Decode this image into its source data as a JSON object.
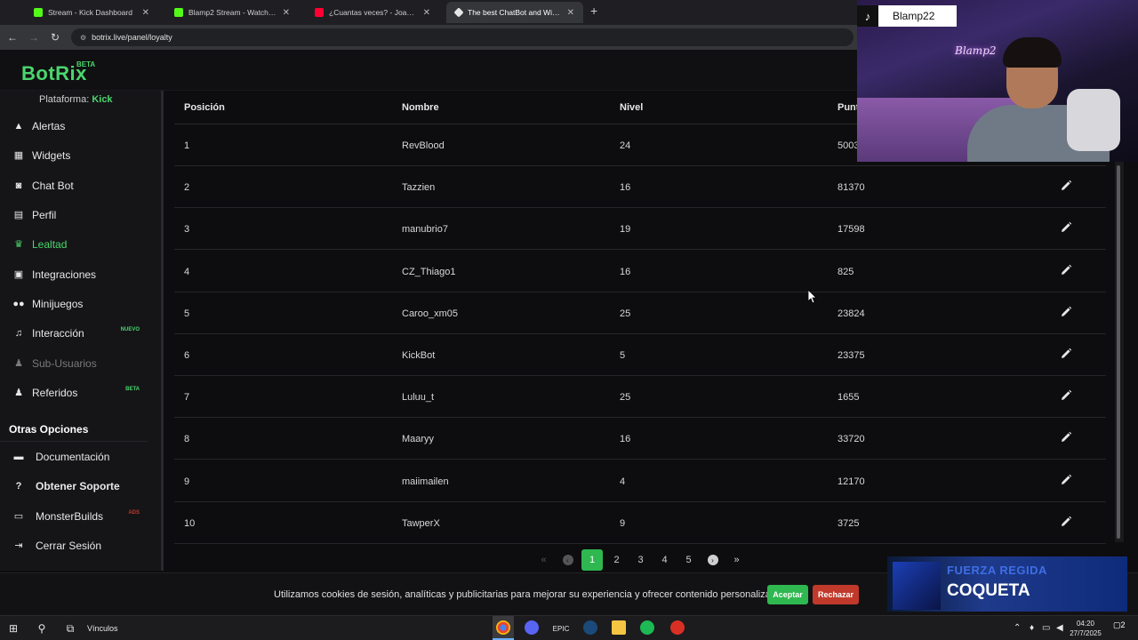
{
  "browser": {
    "tabs": [
      {
        "title": "Stream - Kick Dashboard",
        "favicon_color": "#53fc18"
      },
      {
        "title": "Blamp2 Stream - Watch Live on",
        "favicon_color": "#53fc18"
      },
      {
        "title": "¿Cuantas veces? - Joaco Puppo",
        "favicon_color": "#ff0033"
      },
      {
        "title": "The best ChatBot and Widgets",
        "favicon_color": "#e6e6e6"
      }
    ],
    "url": "botrix.live/panel/loyalty"
  },
  "header": {
    "logo": "BotRix",
    "logo_badge": "BETA"
  },
  "sidebar": {
    "platform_label": "Plataforma:",
    "platform_value": "Kick",
    "items": [
      {
        "label": "Alertas",
        "icon": "warning-icon"
      },
      {
        "label": "Widgets",
        "icon": "grid-icon"
      },
      {
        "label": "Chat Bot",
        "icon": "robot-icon"
      },
      {
        "label": "Perfil",
        "icon": "id-card-icon"
      },
      {
        "label": "Lealtad",
        "icon": "trophy-icon",
        "active": true
      },
      {
        "label": "Integraciones",
        "icon": "integration-icon"
      },
      {
        "label": "Minijuegos",
        "icon": "gamepad-icon"
      },
      {
        "label": "Interacción",
        "icon": "music-icon",
        "tag": "NUEVO"
      },
      {
        "label": "Sub-Usuarios",
        "icon": "users-icon",
        "disabled": true
      },
      {
        "label": "Referidos",
        "icon": "referral-icon",
        "tag": "BETA"
      }
    ],
    "section_title": "Otras Opciones",
    "options": [
      {
        "label": "Documentación",
        "icon": "book-icon"
      },
      {
        "label": "Obtener Soporte",
        "icon": "help-icon",
        "bold": true
      },
      {
        "label": "MonsterBuilds",
        "icon": "monitor-icon",
        "tag": "ADS"
      },
      {
        "label": "Cerrar Sesión",
        "icon": "logout-icon"
      }
    ],
    "accent_color": "#4ad66d"
  },
  "table": {
    "headers": [
      "Posición",
      "Nombre",
      "Nivel",
      "Puntos"
    ],
    "rows": [
      {
        "pos": "1",
        "name": "RevBlood",
        "level": "24",
        "points": "50030"
      },
      {
        "pos": "2",
        "name": "Tazzien",
        "level": "16",
        "points": "81370"
      },
      {
        "pos": "3",
        "name": "manubrio7",
        "level": "19",
        "points": "17598"
      },
      {
        "pos": "4",
        "name": "CZ_Thiago1",
        "level": "16",
        "points": "825"
      },
      {
        "pos": "5",
        "name": "Caroo_xm05",
        "level": "25",
        "points": "23824"
      },
      {
        "pos": "6",
        "name": "KickBot",
        "level": "5",
        "points": "23375"
      },
      {
        "pos": "7",
        "name": "Luluu_t",
        "level": "25",
        "points": "1655"
      },
      {
        "pos": "8",
        "name": "Maaryy",
        "level": "16",
        "points": "33720"
      },
      {
        "pos": "9",
        "name": "maiimailen",
        "level": "4",
        "points": "12170"
      },
      {
        "pos": "10",
        "name": "TawperX",
        "level": "9",
        "points": "3725"
      }
    ]
  },
  "pagination": {
    "pages": [
      "1",
      "2",
      "3",
      "4",
      "5"
    ],
    "current": "1",
    "first": "«",
    "prev": "‹",
    "next": "›",
    "last": "»"
  },
  "cookies": {
    "text": "Utilizamos cookies de sesión, analíticas y publicitarias para mejorar su experiencia y ofrecer contenido personalizado.",
    "accept": "Aceptar",
    "reject": "Rechazar"
  },
  "now_playing": {
    "artist": "FUERZA REGIDA",
    "song": "COQUETA"
  },
  "overlay": {
    "tiktok_name": "Blamp22",
    "neon_sign": "Blamp2"
  },
  "taskbar": {
    "links_label": "Vínculos",
    "time": "04:20",
    "date": "27/7/2025",
    "notifications": "2"
  }
}
